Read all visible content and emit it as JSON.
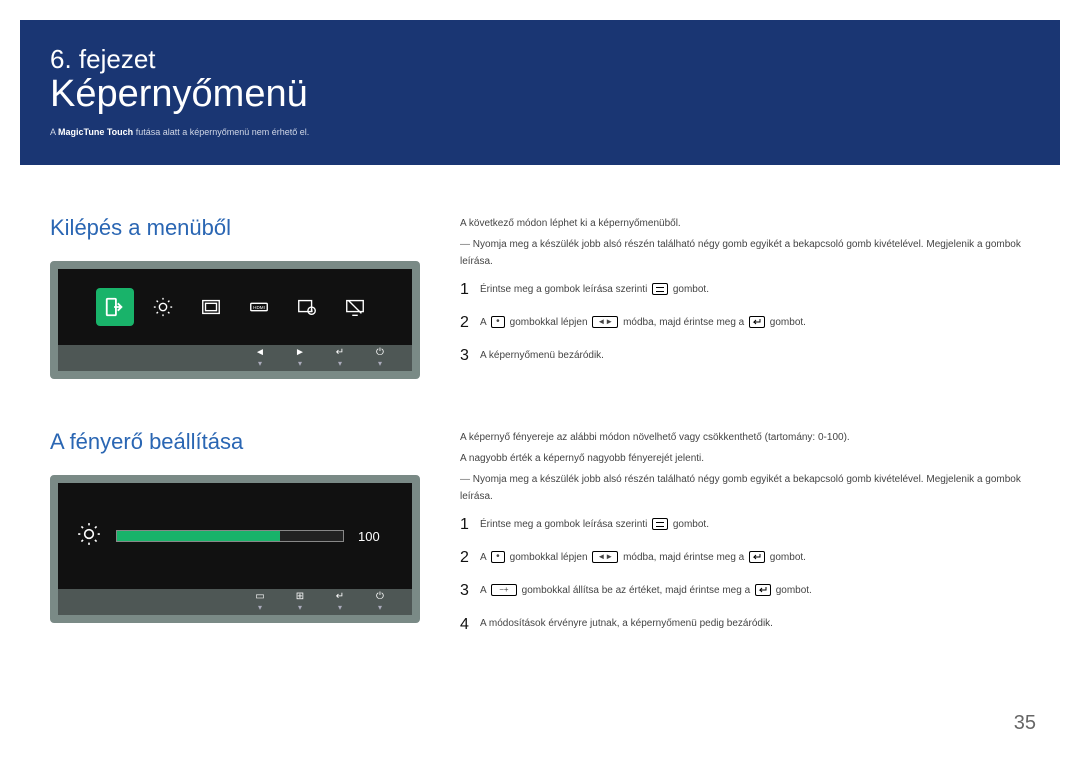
{
  "header": {
    "chapter_label": "6. fejezet",
    "chapter_title": "Képernyőmenü",
    "note_prefix": "A ",
    "note_bold": "MagicTune Touch",
    "note_suffix": " futása alatt a képernyőmenü nem érhető el."
  },
  "section_exit": {
    "heading": "Kilépés a menüből",
    "intro": "A következő módon léphet ki a képernyőmenüből.",
    "dash": "Nyomja meg a készülék jobb alsó részén található négy gomb egyikét a bekapcsoló gomb kivételével. Megjelenik a gombok leírása.",
    "steps": [
      {
        "n": "1",
        "pre": "Érintse meg a gombok leírása szerinti ",
        "post": " gombot."
      },
      {
        "n": "2",
        "pre": "A ",
        "mid": " gombokkal lépjen ",
        "mid2": " módba, majd érintse meg a ",
        "post": " gombot."
      },
      {
        "n": "3",
        "pre": "A képernyőmenü bezáródik."
      }
    ]
  },
  "section_bright": {
    "heading": "A fényerő beállítása",
    "brightness_value": "100",
    "intro": "A képernyő fényereje az alábbi módon növelhető vagy csökkenthető (tartomány: 0-100).",
    "sub": "A nagyobb érték a képernyő nagyobb fényerejét jelenti.",
    "dash": "Nyomja meg a készülék jobb alsó részén található négy gomb egyikét a bekapcsoló gomb kivételével. Megjelenik a gombok leírása.",
    "steps": [
      {
        "n": "1",
        "pre": "Érintse meg a gombok leírása szerinti ",
        "post": " gombot."
      },
      {
        "n": "2",
        "pre": "A ",
        "mid": " gombokkal lépjen ",
        "mid2": " módba, majd érintse meg a ",
        "post": " gombot."
      },
      {
        "n": "3",
        "pre": "A ",
        "mid": " gombokkal állítsa be az értéket, majd érintse meg a ",
        "post": " gombot."
      },
      {
        "n": "4",
        "pre": "A módosítások érvényre jutnak, a képernyőmenü pedig bezáródik."
      }
    ]
  },
  "page_number": "35"
}
